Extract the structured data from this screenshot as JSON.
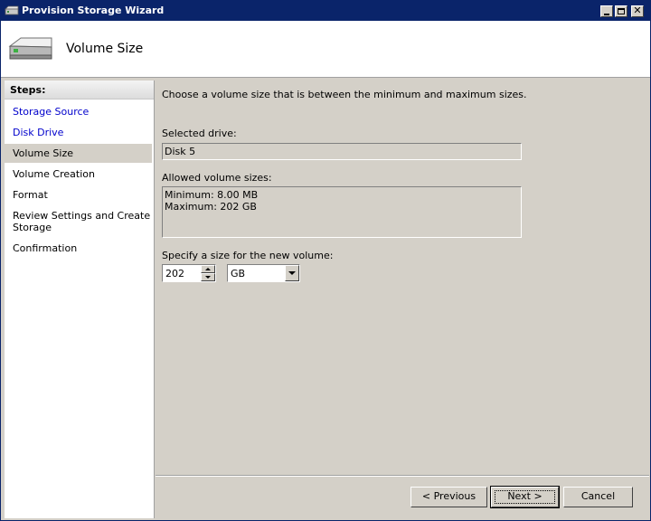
{
  "window": {
    "title": "Provision Storage Wizard"
  },
  "header": {
    "title": "Volume Size",
    "icon": "hard-drive-icon"
  },
  "sidebar": {
    "title": "Steps:",
    "steps": [
      {
        "label": "Storage Source",
        "state": "link"
      },
      {
        "label": "Disk Drive",
        "state": "link"
      },
      {
        "label": "Volume Size",
        "state": "current"
      },
      {
        "label": "Volume Creation",
        "state": "pending"
      },
      {
        "label": "Format",
        "state": "pending"
      },
      {
        "label": "Review Settings and Create Storage",
        "state": "pending"
      },
      {
        "label": "Confirmation",
        "state": "pending"
      }
    ]
  },
  "main": {
    "instruction": "Choose a volume size that is between the minimum and maximum sizes.",
    "selected_drive_label": "Selected drive:",
    "selected_drive_value": "Disk 5",
    "allowed_sizes_label": "Allowed volume sizes:",
    "allowed_min": "Minimum: 8.00 MB",
    "allowed_max": "Maximum: 202 GB",
    "size_label": "Specify a size for the new volume:",
    "size_value": "202",
    "unit_value": "GB"
  },
  "buttons": {
    "previous": "< Previous",
    "next": "Next >",
    "cancel": "Cancel"
  },
  "colors": {
    "titlebar": "#0a246a",
    "link": "#0000cc",
    "face": "#d4d0c8"
  }
}
